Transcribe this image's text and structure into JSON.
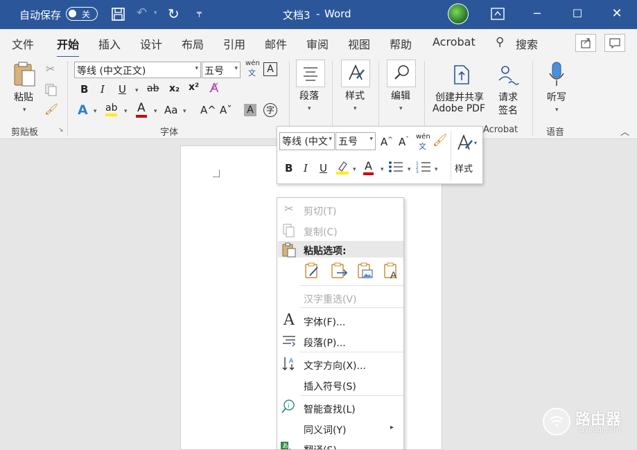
{
  "titlebar": {
    "autosave_label": "自动保存",
    "toggle_state": "关",
    "doc_title": "文档3",
    "separator": "-",
    "app_name": "Word",
    "colors": {
      "bar": "#2b579a"
    }
  },
  "tabs": [
    {
      "label": "文件"
    },
    {
      "label": "开始"
    },
    {
      "label": "插入"
    },
    {
      "label": "设计"
    },
    {
      "label": "布局"
    },
    {
      "label": "引用"
    },
    {
      "label": "邮件"
    },
    {
      "label": "审阅"
    },
    {
      "label": "视图"
    },
    {
      "label": "帮助"
    },
    {
      "label": "Acrobat"
    },
    {
      "label": "搜索"
    }
  ],
  "ribbon": {
    "clipboard": {
      "paste": "粘贴",
      "group": "剪贴板"
    },
    "font": {
      "font_name": "等线 (中文正文)",
      "font_size": "五号",
      "wen": "wén",
      "wen_zh": "文",
      "box_a": "A",
      "bold": "B",
      "italic": "I",
      "underline": "U",
      "strike": "ab",
      "sub": "x₂",
      "sup": "x²",
      "text_effect": "A",
      "highlight": "ab",
      "font_color": "A",
      "case": "Aa",
      "grow": "A^",
      "shrink": "Aˇ",
      "shade_a": "A",
      "circle": "字",
      "group": "字体"
    },
    "paragraph": {
      "label": "段落"
    },
    "styles": {
      "label": "样式"
    },
    "editing": {
      "label": "编辑"
    },
    "acrobat": {
      "create_line1": "创建并共享",
      "create_line2": "Adobe PDF",
      "sign_line1": "请求",
      "sign_line2": "签名",
      "group": "Acrobat"
    },
    "voice": {
      "dictate": "听写",
      "group": "语音"
    }
  },
  "mini_toolbar": {
    "font_name": "等线 (中文",
    "font_size": "五号",
    "wen": "wén",
    "wen_zh": "文",
    "bold": "B",
    "italic": "I",
    "underline": "U",
    "styles": "样式"
  },
  "context_menu": {
    "cut": "剪切(T)",
    "copy": "复制(C)",
    "paste_options": "粘贴选项:",
    "reconvert": "汉字重选(V)",
    "font": "字体(F)...",
    "paragraph": "段落(P)...",
    "text_direction": "文字方向(X)...",
    "insert_symbol": "插入符号(S)",
    "smart_lookup": "智能查找(L)",
    "synonyms": "同义词(Y)",
    "translate": "翻译(S)"
  },
  "watermark": {
    "brand": "路由器",
    "url": "luyouqi.com"
  }
}
